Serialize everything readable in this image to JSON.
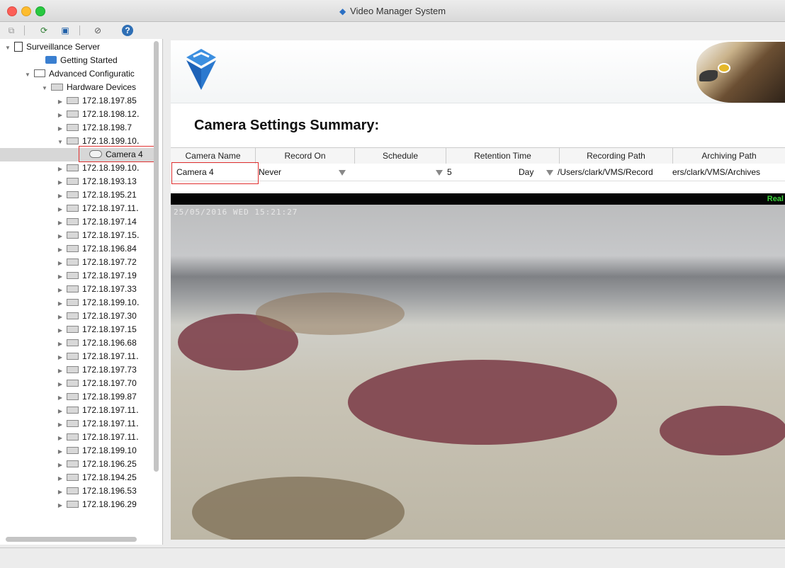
{
  "window": {
    "title": "Video Manager System"
  },
  "tree": {
    "root": "Surveillance Server",
    "getting_started": "Getting Started",
    "advanced": "Advanced Configuratic",
    "hardware": "Hardware Devices",
    "devices": [
      "172.18.197.85",
      "172.18.198.12․",
      "172.18.198.7",
      "172.18.199.10․"
    ],
    "camera": "Camera 4",
    "devices_after": [
      "172.18.199.10․",
      "172.18.193.13",
      "172.18.195.21",
      "172.18.197.11․",
      "172.18.197.14",
      "172.18.197.15․",
      "172.18.196.84",
      "172.18.197.72",
      "172.18.197.19",
      "172.18.197.33",
      "172.18.199.10․",
      "172.18.197.30",
      "172.18.197.15",
      "172.18.196.68",
      "172.18.197.11․",
      "172.18.197.73",
      "172.18.197.70",
      "172.18.199.87",
      "172.18.197.11․",
      "172.18.197.11․",
      "172.18.197.11․",
      "172.18.199.10",
      "172.18.196.25",
      "172.18.194.25",
      "172.18.196.53",
      "172.18.196.29"
    ]
  },
  "main": {
    "section_title": "Camera Settings Summary:",
    "columns": [
      "Camera Name",
      "Record On",
      "Schedule",
      "Retention Time",
      "Recording Path",
      "Archiving Path"
    ],
    "row": {
      "camera_name": "Camera 4",
      "record_on": "Never",
      "schedule": "",
      "retention_value": "5",
      "retention_unit": "Day",
      "recording_path": "/Users/clark/VMS/Record",
      "archiving_path": "ers/clark/VMS/Archives"
    },
    "video": {
      "timestamp": "25/05/2016 WED 15:21:27",
      "status": "Real"
    }
  },
  "colors": {
    "highlight_box": "#e03030",
    "accent": "#2a6fc4"
  }
}
